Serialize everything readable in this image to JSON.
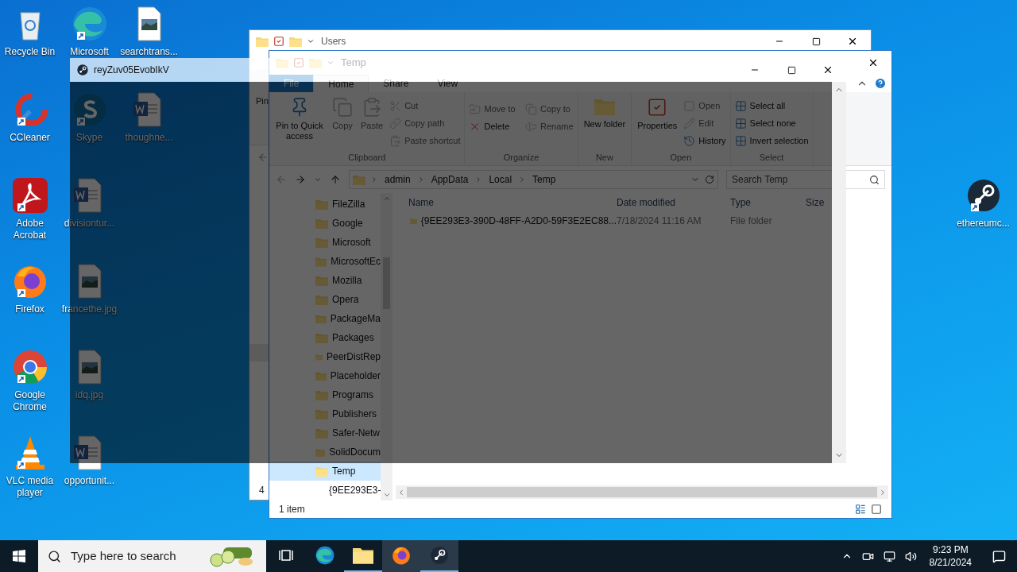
{
  "desktop": {
    "columns": [
      [
        {
          "label": "Recycle Bin",
          "kind": "recycle"
        },
        {
          "label": "CCleaner",
          "kind": "ccleaner"
        },
        {
          "label": "Adobe Acrobat",
          "kind": "acrobat"
        },
        {
          "label": "Firefox",
          "kind": "firefox"
        },
        {
          "label": "Google Chrome",
          "kind": "chrome"
        },
        {
          "label": "VLC media player",
          "kind": "vlc"
        }
      ],
      [
        {
          "label": "Microsoft",
          "kind": "edge"
        },
        {
          "label": "Skype",
          "kind": "skype"
        },
        {
          "label": "divisiontur...",
          "kind": "word"
        },
        {
          "label": "francethe.jpg",
          "kind": "image"
        },
        {
          "label": "idq.jpg",
          "kind": "image"
        },
        {
          "label": "opportunit...",
          "kind": "word"
        }
      ],
      [
        {
          "label": "searchtrans...",
          "kind": "image"
        },
        {
          "label": "thoughne...",
          "kind": "word"
        }
      ]
    ],
    "right_icons": [
      {
        "label": "ethereumc...",
        "kind": "steam"
      }
    ]
  },
  "users_window": {
    "title": "Users",
    "ribbon_text": "Pin",
    "status": "4"
  },
  "temp_window": {
    "title": "Temp",
    "tabs": [
      {
        "label": "File",
        "selected": false,
        "kind": "file"
      },
      {
        "label": "Home",
        "selected": true,
        "kind": "tab"
      },
      {
        "label": "Share",
        "selected": false,
        "kind": "tab"
      },
      {
        "label": "View",
        "selected": false,
        "kind": "tab"
      }
    ],
    "ribbon": [
      {
        "group": "Clipboard",
        "large_items": [
          {
            "label": "Pin to Quick access",
            "kind": "pin",
            "disabled": false
          },
          {
            "label": "Copy",
            "kind": "copy",
            "disabled": true
          },
          {
            "label": "Paste",
            "kind": "paste",
            "disabled": true
          }
        ],
        "small_items": [
          {
            "label": "Cut",
            "kind": "cut",
            "disabled": true
          },
          {
            "label": "Copy path",
            "kind": "path",
            "disabled": true
          },
          {
            "label": "Paste shortcut",
            "kind": "shortcut",
            "disabled": true
          }
        ]
      },
      {
        "group": "Organize",
        "small_items": [
          {
            "label": "Move to",
            "kind": "move",
            "disabled": true
          },
          {
            "label": "Copy to",
            "kind": "copy",
            "disabled": true
          },
          {
            "label": "Delete",
            "kind": "delete",
            "disabled": false
          },
          {
            "label": "Rename",
            "kind": "rename",
            "disabled": true
          }
        ]
      },
      {
        "group": "New",
        "large_items": [
          {
            "label": "New folder",
            "kind": "folder",
            "disabled": false
          }
        ]
      },
      {
        "group": "Open",
        "large_items": [
          {
            "label": "Properties",
            "kind": "properties",
            "disabled": false
          }
        ],
        "small_items": [
          {
            "label": "Open",
            "kind": "open",
            "disabled": true
          },
          {
            "label": "Edit",
            "kind": "edit",
            "disabled": true
          },
          {
            "label": "History",
            "kind": "history",
            "disabled": false
          }
        ]
      },
      {
        "group": "Select",
        "small_items": [
          {
            "label": "Select all",
            "kind": "all",
            "disabled": false
          },
          {
            "label": "Select none",
            "kind": "none",
            "disabled": false
          },
          {
            "label": "Invert selection",
            "kind": "invert",
            "disabled": false
          }
        ]
      }
    ],
    "path": [
      "admin",
      "AppData",
      "Local",
      "Temp"
    ],
    "search": {
      "placeholder": "Search Temp"
    },
    "nav": [
      {
        "label": "FileZilla",
        "selected": false
      },
      {
        "label": "Google",
        "selected": false
      },
      {
        "label": "Microsoft",
        "selected": false
      },
      {
        "label": "MicrosoftEc",
        "selected": false
      },
      {
        "label": "Mozilla",
        "selected": false
      },
      {
        "label": "Opera",
        "selected": false
      },
      {
        "label": "PackageMa",
        "selected": false
      },
      {
        "label": "Packages",
        "selected": false
      },
      {
        "label": "PeerDistRep",
        "selected": false
      },
      {
        "label": "Placeholder",
        "selected": false
      },
      {
        "label": "Programs",
        "selected": false
      },
      {
        "label": "Publishers",
        "selected": false
      },
      {
        "label": "Safer-Netw",
        "selected": false
      },
      {
        "label": "SolidDocum",
        "selected": false
      },
      {
        "label": "Temp",
        "selected": true,
        "children": [
          {
            "label": "{9EE293E3-",
            "selected": false
          }
        ]
      }
    ],
    "columns": [
      "Name",
      "Date modified",
      "Type",
      "Size"
    ],
    "rows": [
      [
        "{9EE293E3-390D-48FF-A2D0-59F3E2EC88...",
        "7/18/2024 11:16 AM",
        "File folder"
      ]
    ],
    "status": "1 item"
  },
  "overlay_window": {
    "title": "reyZuv05EvobIkV"
  },
  "taskbar": {
    "search_placeholder": "Type here to search",
    "apps": [
      {
        "kind": "taskview",
        "running": false,
        "highlighted": false
      },
      {
        "kind": "edge",
        "running": false,
        "highlighted": false
      },
      {
        "kind": "explorer",
        "running": true,
        "highlighted": false
      },
      {
        "kind": "firefox",
        "running": false,
        "highlighted": true
      },
      {
        "kind": "steam",
        "running": true,
        "highlighted": true
      }
    ],
    "time": "9:23 PM",
    "date": "8/21/2024"
  }
}
